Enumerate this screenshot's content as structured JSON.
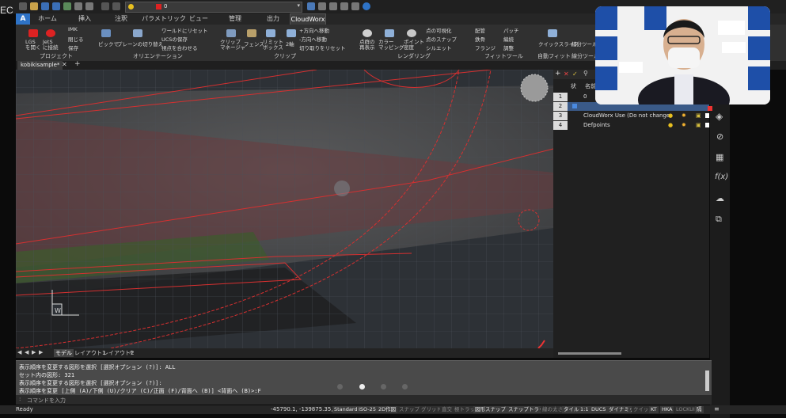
{
  "corner_label": "EC",
  "quick_access": {
    "layer_dropdown_value": "0"
  },
  "ribbon_tabs": [
    {
      "label": "ホーム"
    },
    {
      "label": "挿入"
    },
    {
      "label": "注釈"
    },
    {
      "label": "パラメトリック"
    },
    {
      "label": "ビュー"
    },
    {
      "label": "管理"
    },
    {
      "label": "出力"
    },
    {
      "label": "CloudWorx"
    }
  ],
  "app_button": "A",
  "ribbon": {
    "project": {
      "buttons": [
        "LGS\nを開く",
        "JetS\nに接続",
        "IMK",
        "閉じる",
        "保存"
      ],
      "label": "プロジェクト"
    },
    "orientation": {
      "buttons": [
        "ピックで",
        "プレーンの切り替え",
        "ワールドにリセット",
        "UCSの保存",
        "視点を合わせる"
      ],
      "label": "オリエンテーション"
    },
    "clip": {
      "buttons": [
        "クリップ\nマネージャ",
        "フェンス",
        "リミット\nボックス",
        "2軸",
        "+方向へ移動",
        "-方向へ移動",
        "切り取りをリセット"
      ],
      "label": "クリップ"
    },
    "render": {
      "buttons": [
        "点群の\n再表示",
        "カラー\nマッピング",
        "ポイント\n密度",
        "点の可視化",
        "点のスナップ",
        "シルエット"
      ],
      "label": "レンダリング"
    },
    "fit": {
      "buttons": [
        "配管",
        "鉄骨",
        "フランジ",
        "パッチ",
        "編続",
        "調整"
      ],
      "label": "フィットツール"
    },
    "quick": {
      "buttons": [
        "クイックスライス",
        "線分ツール"
      ],
      "label": "自動フィット",
      "label2": "線分ツール"
    }
  },
  "document_tab": "kobikisample*",
  "viewport": {
    "ucs_label": "W"
  },
  "layout_tabs": {
    "model": "モデル",
    "layout1": "レイアウト1",
    "layout2": "レイアウト2"
  },
  "layer_panel": {
    "header_col1": "状",
    "header_col2": "名前",
    "rows": [
      {
        "num": "1",
        "name": "0"
      },
      {
        "num": "2",
        "name": ""
      },
      {
        "num": "3",
        "name": "CloudWorx Use (Do not change"
      },
      {
        "num": "4",
        "name": "Defpoints"
      }
    ]
  },
  "command_history": [
    "表示順序を変更する図形を選択 [選択オプション (?)]: ALL",
    "セット内の図形: 321",
    "表示順序を変更する図形を選択 [選択オプション (?)]:",
    "表示順序を変更 [上側 (A)/下側 (U)/クリア (C)/正面 (F)/背面へ (B)] <背面へ (B)>:F"
  ],
  "command_prompt": "コマンドを入力",
  "status_bar": {
    "ready": "Ready",
    "coords": "-45790.1, -139875.35, 0",
    "standard": "Standard",
    "iso": "ISO-25",
    "dim": "2D作図",
    "snap": "スナップ",
    "grid": "グリッド",
    "ortho": "直交",
    "polar": "極トラッキング",
    "osnap": "図形スナップ",
    "otrack": "スナップトラック",
    "lineweight": "線の太さ",
    "tile": "タイル",
    "scale": "1:1",
    "ducs": "DUCS",
    "dyn": "ダイナミック",
    "qp": "クイック",
    "kt": "KT",
    "hka": "HKA",
    "lockui": "LOCKUI",
    "iso2": "隔"
  },
  "colors": {
    "accent_blue": "#2e73c7",
    "boundary_red": "#d63030",
    "grid": "#4a5058"
  }
}
